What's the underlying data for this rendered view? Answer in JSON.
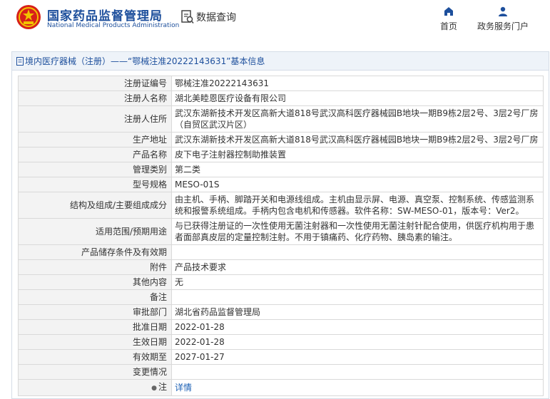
{
  "header": {
    "site_name_cn": "国家药品监督管理局",
    "site_name_en": "National Medical Products Administration",
    "query_label": "数据查询",
    "nav_home": "首页",
    "nav_portal": "政务服务门户"
  },
  "panel": {
    "title": "境内医疗器械（注册）——“鄂械注准20222143631”基本信息"
  },
  "rows": [
    {
      "label": "注册证编号",
      "value": "鄂械注准20222143631"
    },
    {
      "label": "注册人名称",
      "value": "湖北美睦恩医疗设备有限公司"
    },
    {
      "label": "注册人住所",
      "value": "武汉东湖新技术开发区高新大道818号武汉高科医疗器械园B地块一期B9栋2层2号、3层2号厂房（自贸区武汉片区）"
    },
    {
      "label": "生产地址",
      "value": "武汉东湖新技术开发区高新大道818号武汉高科医疗器械园B地块一期B9栋2层2号、3层2号厂房"
    },
    {
      "label": "产品名称",
      "value": "皮下电子注射器控制助推装置"
    },
    {
      "label": "管理类别",
      "value": "第二类"
    },
    {
      "label": "型号规格",
      "value": "MESO-01S"
    },
    {
      "label": "结构及组成/主要组成成分",
      "value": "由主机、手柄、脚踏开关和电源线组成。主机由显示屏、电源、真空泵、控制系统、传感监测系统和报警系统组成。手柄内包含电机和传感器。软件名称：SW-MESO-01，版本号：Ver2。"
    },
    {
      "label": "适用范围/预期用途",
      "value": "与已获得注册证的一次性使用无菌注射器和一次性使用无菌注射针配合使用，供医疗机构用于患者面部真皮层的定量控制注射。不用于镇痛药、化疗药物、胰岛素的输注。"
    },
    {
      "label": "产品储存条件及有效期",
      "value": ""
    },
    {
      "label": "附件",
      "value": "产品技术要求"
    },
    {
      "label": "其他内容",
      "value": "无"
    },
    {
      "label": "备注",
      "value": ""
    },
    {
      "label": "审批部门",
      "value": "湖北省药品监督管理局"
    },
    {
      "label": "批准日期",
      "value": "2022-01-28"
    },
    {
      "label": "生效日期",
      "value": "2022-01-28"
    },
    {
      "label": "有效期至",
      "value": "2027-01-27"
    },
    {
      "label": "变更情况",
      "value": ""
    }
  ],
  "note_row": {
    "label": "注",
    "link": "详情"
  }
}
